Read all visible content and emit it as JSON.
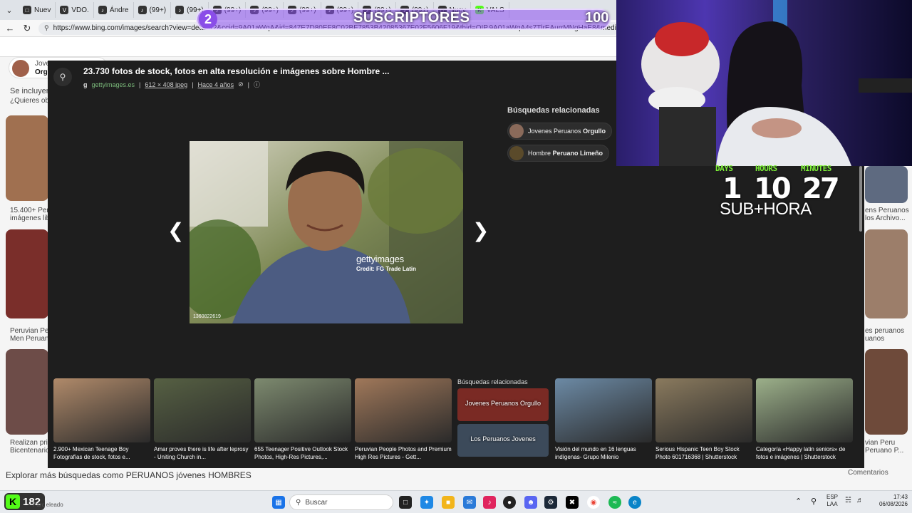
{
  "browser": {
    "tabs": [
      {
        "label": "Nuev",
        "icon": "page-icon"
      },
      {
        "label": "VDO.",
        "icon": "vdo-icon"
      },
      {
        "label": "Ándre",
        "icon": "tiktok-icon"
      },
      {
        "label": "(99+)",
        "icon": "tiktok-icon"
      },
      {
        "label": "(99+)",
        "icon": "tiktok-icon"
      },
      {
        "label": "(99+)",
        "icon": "tiktok-icon"
      },
      {
        "label": "(99+)",
        "icon": "tiktok-icon"
      },
      {
        "label": "(99+)",
        "icon": "tiktok-icon"
      },
      {
        "label": "(99+)",
        "icon": "tiktok-icon"
      },
      {
        "label": "(99+)",
        "icon": "tiktok-icon"
      },
      {
        "label": "(99+)",
        "icon": "tiktok-icon"
      },
      {
        "label": "Nuev",
        "icon": "page-icon"
      },
      {
        "label": "VALS",
        "icon": "kick-icon"
      }
    ],
    "url": "https://www.bing.com/images/search?view=detailV2&ccid=9A01aWqA&id=847E7D80EF8C02BF7853B42085367E02F5606F19&thid=OIP.9A01aWqA4s7TlrEAurrMNgHaE8&mediaurl=https%3a%2f%2fmedia"
  },
  "bing": {
    "left_top_label": "Joven",
    "left_top_sub": "Org",
    "included_text": "Se incluyen",
    "want_text": "¿Quieres obt",
    "left_cards": [
      {
        "line1": "15.400+ Peru",
        "line2": "imágenes libre"
      },
      {
        "line1": "Peruvian Peru",
        "line2": "Men Peruano"
      },
      {
        "line1": "Realizan pri",
        "line2": "Bicentenario,"
      }
    ],
    "right_cards": [
      {
        "line1": "ens Peruanos",
        "line2": "los Archivo..."
      },
      {
        "line1": "es peruanos",
        "line2": "uanos"
      },
      {
        "line1": "vian Peru",
        "line2": "Peruano P..."
      }
    ],
    "explore": "Explorar más búsquedas como PERUANOS jóvenes HOMBRES",
    "comments": "Comentarios"
  },
  "viewer": {
    "title": "23.730 fotos de stock, fotos en alta resolución e imágenes sobre Hombre ...",
    "source": "gettyimages.es",
    "dimensions": "612 × 408 jpeg",
    "age": "Hace 4 años",
    "watermark": "gettyimages",
    "credit": "Credit: FG Trade Latin",
    "image_id": "1360822619",
    "related_heading": "Búsquedas relacionadas",
    "related_chips": [
      {
        "normal": "Jovenes Peruanos ",
        "bold": "Orgullo"
      },
      {
        "normal": "Hombre ",
        "bold": "Peruano Limeño"
      }
    ],
    "strip": [
      {
        "caption": "2.900+ Mexican Teenage Boy Fotografías de stock, fotos e...",
        "color": "#b08a6a"
      },
      {
        "caption": "Amar proves there is life after leprosy - Uniting Church in...",
        "color": "#566043"
      },
      {
        "caption": "655 Teenager Positive Outlook Stock Photos, High-Res Pictures,...",
        "color": "#7d8a6f"
      },
      {
        "caption": "Peruvian People Photos and Premium High Res Pictures - Gett...",
        "color": "#a0785a"
      },
      {
        "caption": "Visión del mundo en 16 lenguas indígenas- Grupo Milenio",
        "color": "#6c8aa5"
      },
      {
        "caption": "Serious Hispanic Teen Boy Stock Photo 601716368 | Shutterstock",
        "color": "#8a7a5e"
      },
      {
        "caption": "Categoría «Happy latin seniors» de fotos e imágenes | Shutterstock",
        "color": "#9cb08a"
      }
    ],
    "strip_related_heading": "Búsquedas relacionadas",
    "strip_related": [
      "Jovenes Peruanos Orgullo",
      "Los Peruanos Jovenes"
    ]
  },
  "overlay": {
    "subs_count": "2",
    "subs_label": "SUSCRIPTORES",
    "subs_goal": "100",
    "timer_labels": [
      "DAYS",
      "HOURS",
      "MINUTES"
    ],
    "timer_values": [
      "1",
      "10",
      "27"
    ],
    "subhora": "SUB+HORA",
    "kick_count": "182",
    "kick_sub": "Parc  eleado"
  },
  "taskbar": {
    "search_placeholder": "Buscar",
    "lang": "ESP",
    "lang_sub": "LAA",
    "time": "17:43",
    "date": "06/08/2026"
  }
}
